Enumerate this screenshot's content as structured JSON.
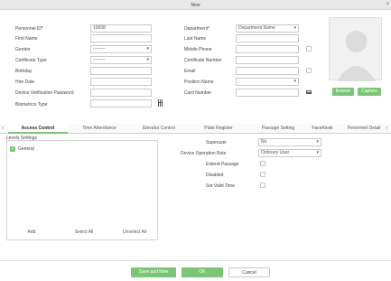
{
  "window": {
    "title": "New",
    "close_glyph": "×"
  },
  "form_left": {
    "personnel_id": {
      "label": "Personnel ID*",
      "value": "10008"
    },
    "first_name": {
      "label": "First Name",
      "value": ""
    },
    "gender": {
      "label": "Gender",
      "value": "--------"
    },
    "certificate_type": {
      "label": "Certificate Type",
      "value": "--------"
    },
    "birthday": {
      "label": "Birthday",
      "value": ""
    },
    "hire_date": {
      "label": "Hire Date",
      "value": ""
    },
    "device_verification_password": {
      "label": "Device Verification Password",
      "value": ""
    },
    "biometrics_type": {
      "label": "Biometrics Type",
      "value": ""
    }
  },
  "form_right": {
    "department": {
      "label": "Department*",
      "value": "Department Name"
    },
    "last_name": {
      "label": "Last Name",
      "value": ""
    },
    "mobile_phone": {
      "label": "Mobile Phone",
      "value": ""
    },
    "certificate_number": {
      "label": "Certificate Number",
      "value": ""
    },
    "email": {
      "label": "Email",
      "value": ""
    },
    "position_name": {
      "label": "Position Name",
      "value": ""
    },
    "card_number": {
      "label": "Card Number",
      "value": ""
    }
  },
  "photo": {
    "browse_label": "Browse",
    "capture_label": "Capture"
  },
  "tabs": [
    {
      "label": "Access Control"
    },
    {
      "label": "Time Attendance"
    },
    {
      "label": "Elevator Control"
    },
    {
      "label": "Plate Register"
    },
    {
      "label": "Passage Setting"
    },
    {
      "label": "FaceKiosk"
    },
    {
      "label": "Personnel Detail"
    }
  ],
  "access": {
    "levels_title": "Levels Settings",
    "levels": [
      {
        "label": "General",
        "checked": true
      }
    ],
    "buttons": {
      "add": "Add",
      "select_all": "Select All",
      "unselect_all": "Unselect All"
    },
    "superuser": {
      "label": "Superuser",
      "value": "No"
    },
    "device_operation_role": {
      "label": "Device Operation Role",
      "value": "Ordinary User"
    },
    "extend_passage": {
      "label": "Extend Passage"
    },
    "disabled": {
      "label": "Disabled"
    },
    "set_valid_time": {
      "label": "Set Valid Time"
    }
  },
  "footer": {
    "save_and_new": "Save and New",
    "ok": "OK",
    "cancel": "Cancel"
  },
  "colors": {
    "accent": "#7cc576",
    "border": "#c9c9c9"
  }
}
